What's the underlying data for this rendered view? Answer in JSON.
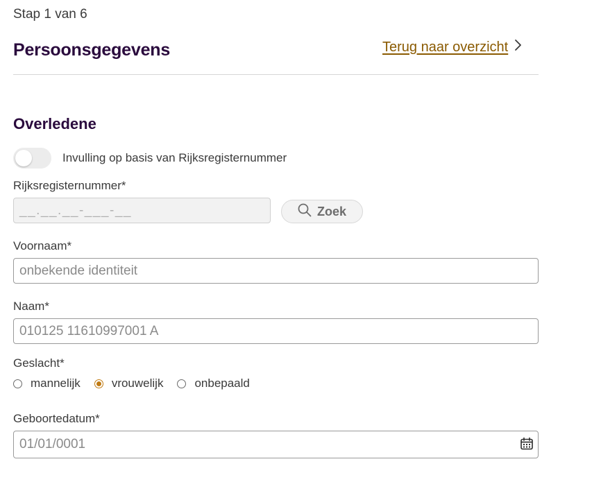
{
  "header": {
    "step": "Stap 1 van 6",
    "title": "Persoonsgegevens",
    "back_link": "Terug naar overzicht"
  },
  "section": {
    "title": "Overledene",
    "toggle_label": "Invulling op basis van Rijksregisternummer",
    "toggle_on": false
  },
  "fields": {
    "rrn": {
      "label": "Rijksregisternummer*",
      "value": "__.__.__-___-__"
    },
    "search_button": "Zoek",
    "firstname": {
      "label": "Voornaam*",
      "value": "onbekende identiteit"
    },
    "name": {
      "label": "Naam*",
      "value": "010125 11610997001 A"
    },
    "gender": {
      "label": "Geslacht*",
      "options": [
        "mannelijk",
        "vrouwelijk",
        "onbepaald"
      ],
      "selected": "vrouwelijk"
    },
    "birthdate": {
      "label": "Geboortedatum*",
      "value": "01/01/0001"
    }
  },
  "colors": {
    "title": "#2a0a3d",
    "link": "#8a5a00",
    "accent": "#c07a12"
  },
  "icons": {
    "back": "chevron-right-icon",
    "search": "search-icon",
    "calendar": "calendar-icon"
  }
}
